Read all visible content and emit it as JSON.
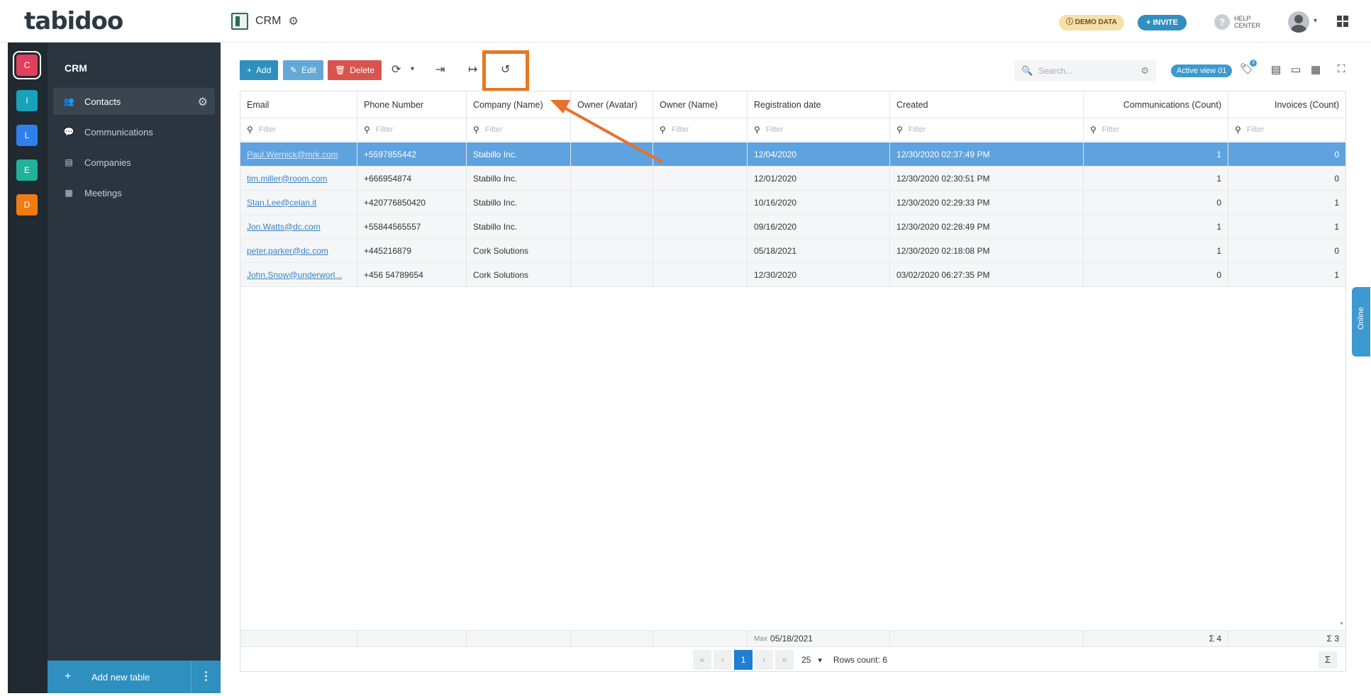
{
  "topbar": {
    "logo": "tabidoo",
    "app_name": "CRM",
    "demo_badge": "ⓘ DEMO DATA",
    "invite": "+ INVITE",
    "help": "HELP CENTER"
  },
  "workspaces": [
    {
      "letter": "C",
      "color": "#e0405e"
    },
    {
      "letter": "I",
      "color": "#17a2b8"
    },
    {
      "letter": "L",
      "color": "#2f80ed"
    },
    {
      "letter": "E",
      "color": "#20b29a"
    },
    {
      "letter": "D",
      "color": "#f07c13"
    }
  ],
  "sidebar": {
    "title": "CRM",
    "items": [
      {
        "label": "Contacts",
        "icon": "people-icon"
      },
      {
        "label": "Communications",
        "icon": "chat-icon"
      },
      {
        "label": "Companies",
        "icon": "table-icon"
      },
      {
        "label": "Meetings",
        "icon": "calendar-icon"
      }
    ],
    "add_table": "Add new table"
  },
  "toolbar": {
    "add": "Add",
    "edit": "Edit",
    "delete": "Delete",
    "search_placeholder": "Search...",
    "active_view": "Active view 01",
    "tag_count": "3"
  },
  "grid": {
    "columns": [
      "Email",
      "Phone Number",
      "Company (Name)",
      "Owner (Avatar)",
      "Owner (Name)",
      "Registration date",
      "Created",
      "Communications (Count)",
      "Invoices (Count)"
    ],
    "filter_placeholder": "Filter",
    "rows": [
      [
        "Paul.Wernick@mrk.com",
        "+5597855442",
        "Stabillo Inc.",
        "",
        "",
        "12/04/2020",
        "12/30/2020 02:37:49 PM",
        "1",
        "0"
      ],
      [
        "tim.miller@room.com",
        "+666954874",
        "Stabillo Inc.",
        "",
        "",
        "12/01/2020",
        "12/30/2020 02:30:51 PM",
        "1",
        "0"
      ],
      [
        "Stan.Lee@celan.it",
        "+420776850420",
        "Stabillo Inc.",
        "",
        "",
        "10/16/2020",
        "12/30/2020 02:29:33 PM",
        "0",
        "1"
      ],
      [
        "Jon.Watts@dc.com",
        "+55844565557",
        "Stabillo Inc.",
        "",
        "",
        "09/16/2020",
        "12/30/2020 02:28:49 PM",
        "1",
        "1"
      ],
      [
        "peter.parker@dc.com",
        "+445216879",
        "Cork Solutions",
        "",
        "",
        "05/18/2021",
        "12/30/2020 02:18:08 PM",
        "1",
        "0"
      ],
      [
        "John.Snow@underworl...",
        "+456 54789654",
        "Cork Solutions",
        "",
        "",
        "12/30/2020",
        "03/02/2020 06:27:35 PM",
        "0",
        "1"
      ]
    ],
    "footer": {
      "max_label": "Max",
      "max_value": "05/18/2021",
      "comm_sum": "Σ 4",
      "inv_sum": "Σ 3"
    },
    "pager": {
      "current": "1",
      "page_size": "25",
      "rows_count": "Rows count: 6"
    }
  },
  "online_tab": "Online"
}
